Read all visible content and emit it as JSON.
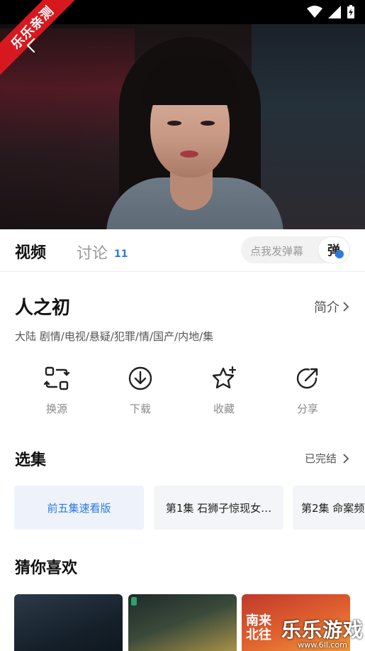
{
  "watermark_ribbon": "乐乐亲测",
  "tabs": {
    "video": "视频",
    "discussion": "讨论",
    "discussion_count": "11"
  },
  "danmu": {
    "placeholder": "点我发弹幕",
    "button": "弹"
  },
  "show": {
    "title": "人之初",
    "intro_link": "简介",
    "tags": "大陆  剧情/电视/悬疑/犯罪/情/国产/内地/集"
  },
  "actions": [
    {
      "label": "换源",
      "icon": "switch-source-icon"
    },
    {
      "label": "下载",
      "icon": "download-icon"
    },
    {
      "label": "收藏",
      "icon": "star-icon"
    },
    {
      "label": "分享",
      "icon": "share-icon"
    }
  ],
  "episodes": {
    "section_title": "选集",
    "status": "已完结",
    "items": [
      "前五集速看版",
      "第1集 石狮子惊现女…",
      "第2集 命案频"
    ]
  },
  "recommend": {
    "section_title": "猜你喜欢",
    "poster3_text": "南来\n北往"
  },
  "site_watermark": {
    "big": "乐乐游戏",
    "small": "www.6ll.com"
  },
  "colors": {
    "accent": "#2a7ae2",
    "ribbon": "#d7191f"
  }
}
